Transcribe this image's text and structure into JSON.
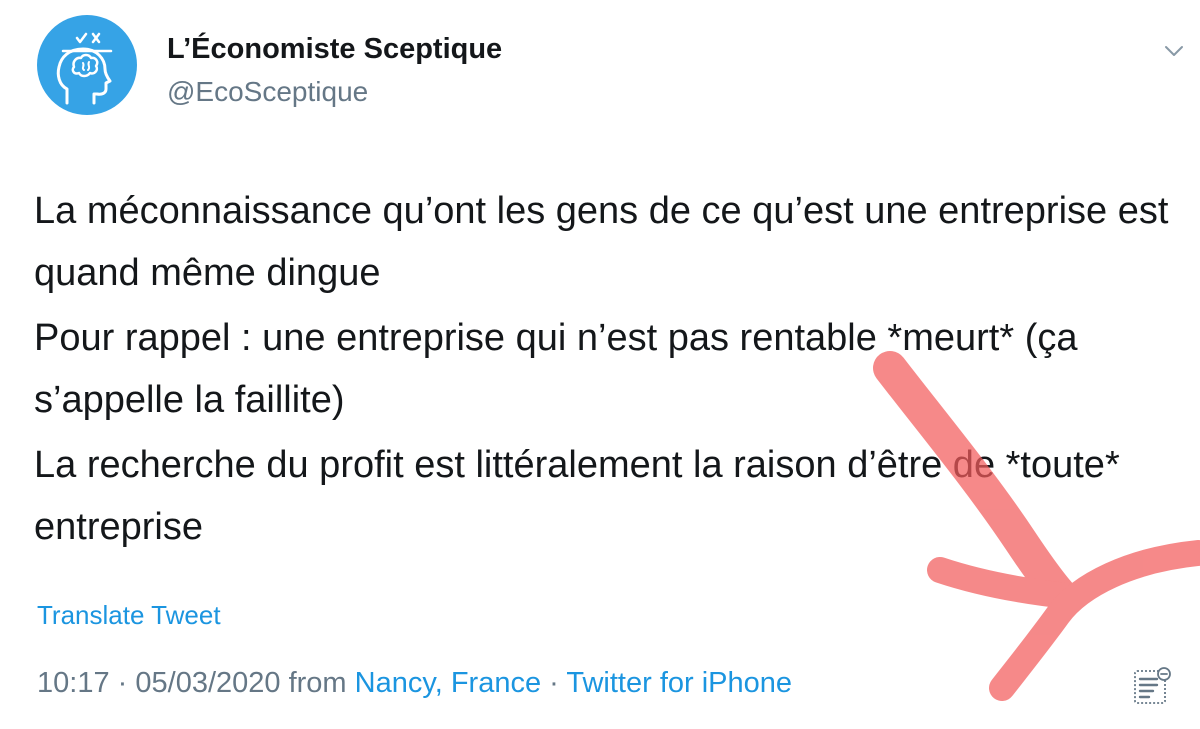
{
  "header": {
    "display_name": "L’Économiste Sceptique",
    "handle": "@EcoSceptique",
    "avatar_icon": "brain-head-icon",
    "menu_icon": "chevron-down-icon"
  },
  "tweet": {
    "paragraphs": [
      "La méconnaissance qu’ont les gens de ce qu’est une entreprise est quand même dingue",
      "Pour rappel : une entreprise qui n’est pas rentable *meurt* (ça s’appelle la faillite)",
      "La recherche du profit est littéralement la raison d’être de *toute* entreprise"
    ],
    "translate_label": "Translate Tweet"
  },
  "meta": {
    "time": "10:17",
    "separator": "·",
    "date": "05/03/2020",
    "from_label": "from",
    "location": "Nancy, France",
    "client": "Twitter for iPhone",
    "analytics_icon": "analytics-icon"
  },
  "colors": {
    "avatar_bg": "#36a3e6",
    "link": "#1b95e0",
    "secondary_text": "#657786",
    "annotation": "#f25c5c"
  }
}
